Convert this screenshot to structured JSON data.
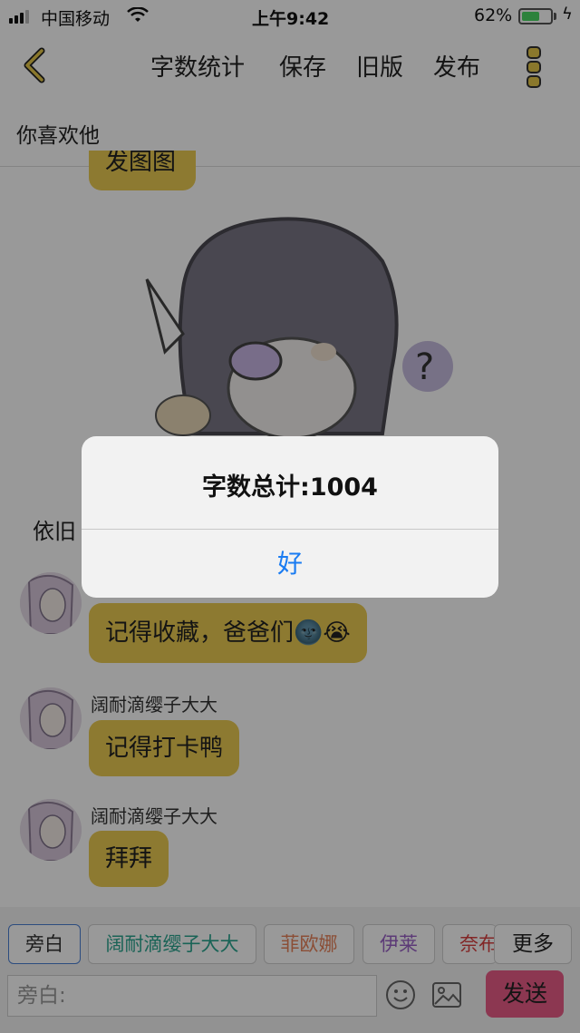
{
  "status_bar": {
    "carrier": "中国移动",
    "time": "上午9:42",
    "battery_percent": "62%",
    "battery_level": 0.62,
    "wifi_icon": "wifi-icon",
    "signal_icon": "signal-icon",
    "charging_icon": "charging-bolt-icon"
  },
  "nav": {
    "back_icon": "chevron-left-icon",
    "word_count_label": "字数统计",
    "save_label": "保存",
    "old_version_label": "旧版",
    "publish_label": "发布",
    "menu_icon": "vertical-dots-icon"
  },
  "chat": {
    "title": "你喜欢他",
    "top_bubble_partial": "发图图",
    "narration_partial": "依旧",
    "messages": [
      {
        "sender": "",
        "text": "记得收藏，爸爸们🌚😭"
      },
      {
        "sender": "阔耐滴缨子大大",
        "text": "记得打卡鸭"
      },
      {
        "sender": "阔耐滴缨子大大",
        "text": "拜拜"
      }
    ]
  },
  "roles": [
    {
      "label": "旁白",
      "color": "#333333"
    },
    {
      "label": "阔耐滴缨子大大",
      "color": "#2aa58f"
    },
    {
      "label": "菲欧娜",
      "color": "#e8825a"
    },
    {
      "label": "伊莱",
      "color": "#9a62c6"
    },
    {
      "label": "奈布",
      "color": "#d94040"
    }
  ],
  "more_label": "更多",
  "input": {
    "placeholder": "旁白:"
  },
  "emoji_icon": "emoji-icon",
  "image_icon": "image-icon",
  "send_label": "发送",
  "dialog": {
    "message": "字数总计:1004",
    "ok_label": "好"
  },
  "colors": {
    "accent_bubble": "#eccb52",
    "send_button": "#e95d88",
    "dialog_button": "#1a7cf2"
  }
}
